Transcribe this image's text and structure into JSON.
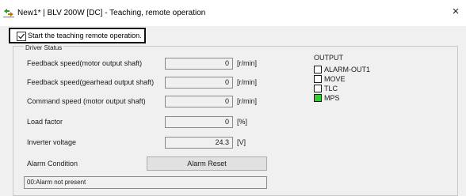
{
  "window": {
    "title": "New1* | BLV 200W [DC] - Teaching, remote operation",
    "app_icon": "teaching-arrows-icon",
    "close_glyph": "×"
  },
  "teaching": {
    "checkbox_label": "Start the teaching remote operation.",
    "checked": true
  },
  "driver_status": {
    "group_title": "Driver Status",
    "rows": [
      {
        "label": "Feedback speed(motor output shaft)",
        "value": "0",
        "unit": "[r/min]"
      },
      {
        "label": "Feedback speed(gearhead output shaft)",
        "value": "0",
        "unit": "[r/min]"
      },
      {
        "label": "Command speed (motor output shaft)",
        "value": "0",
        "unit": "[r/min]"
      },
      {
        "label": "Load factor",
        "value": "0",
        "unit": "[%]"
      },
      {
        "label": "Inverter voltage",
        "value": "24.3",
        "unit": "[V]"
      }
    ],
    "alarm_condition_label": "Alarm Condition",
    "alarm_reset_label": "Alarm Reset",
    "alarm_text": "00:Alarm not present"
  },
  "output": {
    "title": "OUTPUT",
    "items": [
      {
        "label": "ALARM-OUT1",
        "active": false
      },
      {
        "label": "MOVE",
        "active": false
      },
      {
        "label": "TLC",
        "active": false
      },
      {
        "label": "MPS",
        "active": true
      }
    ],
    "active_color": "#33cc33",
    "inactive_color": "#ffffff"
  }
}
